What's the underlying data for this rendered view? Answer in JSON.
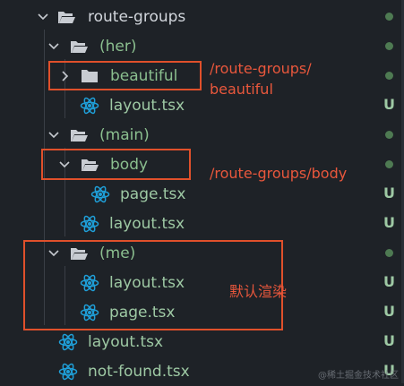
{
  "tree": {
    "route_groups": {
      "label": "route-groups",
      "badge": "dot"
    },
    "her": {
      "label": "(her)",
      "badge": "dot"
    },
    "beautiful": {
      "label": "beautiful",
      "badge": "dot"
    },
    "her_layout": {
      "label": "layout.tsx",
      "badge": "U"
    },
    "main": {
      "label": "(main)",
      "badge": "dot"
    },
    "body": {
      "label": "body",
      "badge": "dot"
    },
    "body_page": {
      "label": "page.tsx",
      "badge": "U"
    },
    "main_layout": {
      "label": "layout.tsx",
      "badge": "U"
    },
    "me": {
      "label": "(me)",
      "badge": "dot"
    },
    "me_layout": {
      "label": "layout.tsx",
      "badge": "U"
    },
    "me_page": {
      "label": "page.tsx",
      "badge": "U"
    },
    "root_layout": {
      "label": "layout.tsx",
      "badge": "U"
    },
    "not_found": {
      "label": "not-found.tsx",
      "badge": "U"
    }
  },
  "annotations": {
    "beautiful_path_line1": "/route-groups/",
    "beautiful_path_line2": "beautiful",
    "body_path": "/route-groups/body",
    "me_note": "默认渲染"
  },
  "watermark": "@稀土掘金技术社区",
  "colors": {
    "background": "#1e2227",
    "file_text": "#9ec9a4",
    "untracked_badge": "#9ec9a4",
    "dot_badge": "#4e7a52",
    "highlight": "#e0502b",
    "react_icon": "#1f9fd8",
    "folder_icon": "#c8ccd2"
  },
  "icons": {
    "folder_open": "folder-open-icon",
    "folder_closed": "folder-icon",
    "react": "react-icon",
    "chevron_down": "chevron-down-icon",
    "chevron_right": "chevron-right-icon"
  }
}
